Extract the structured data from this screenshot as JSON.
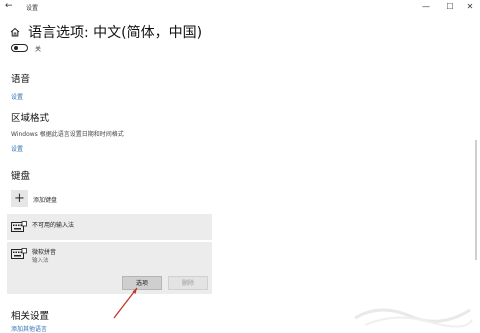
{
  "window": {
    "back_glyph": "←",
    "title": "设置",
    "minimize_glyph": "—",
    "maximize_glyph": "☐",
    "close_glyph": "✕"
  },
  "page": {
    "title": "语言选项: 中文(简体，中国)",
    "toggle_label": "关"
  },
  "language": {
    "heading": "语音",
    "settings_link": "设置"
  },
  "region": {
    "heading": "区域格式",
    "description": "Windows 根据此语言设置日期和时间格式",
    "settings_link": "设置"
  },
  "keyboard": {
    "heading": "键盘",
    "add_label": "添加键盘",
    "items": [
      {
        "label": "不可用的输入法",
        "sub": ""
      },
      {
        "label": "微软拼音",
        "sub": "输入法"
      }
    ],
    "options_button": "选项",
    "delete_button": "删除"
  },
  "related": {
    "heading": "相关设置",
    "link": "添加其他语言"
  },
  "colors": {
    "link": "#2f6fb5",
    "row_bg": "#ececec",
    "arrow": "#c0392b"
  }
}
